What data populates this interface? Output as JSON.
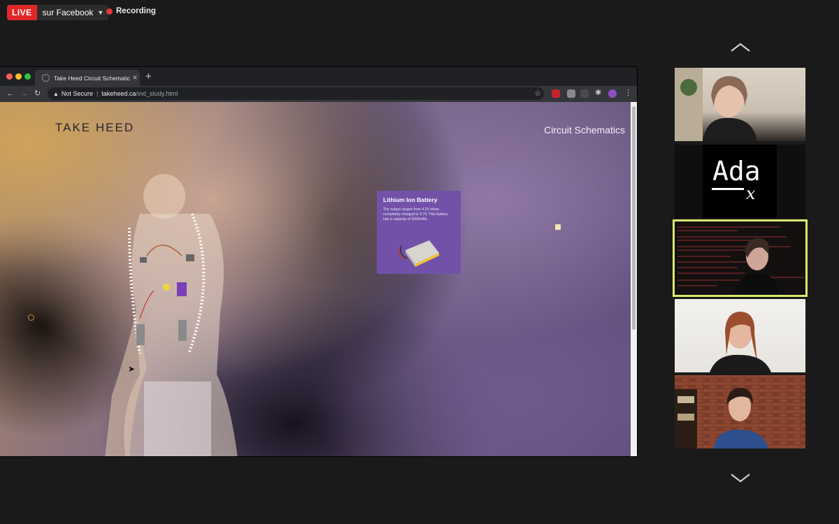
{
  "top_bar": {
    "live_label": "LIVE",
    "live_destination": "sur Facebook",
    "recording_label": "Recording"
  },
  "browser": {
    "tab_title": "Take Heed Circuit Schematics",
    "new_tab_symbol": "+",
    "security_label": "Not Secure",
    "url_domain": "takeheed.ca",
    "url_path": "/ind_study.html"
  },
  "page": {
    "brand": "TAKE HEED",
    "nav_link": "Circuit Schematics",
    "card": {
      "title": "Lithium Ion Battery",
      "body": "The output ranges from 4.2V when completely charged to 3.7V. This battery has a capacity of 2000mAh."
    }
  },
  "participants": {
    "logo_text": "Ada",
    "logo_subscript": "x",
    "tiles": [
      {
        "name": "participant-1",
        "active": false
      },
      {
        "name": "adax-logo",
        "active": false
      },
      {
        "name": "participant-3",
        "active": true
      },
      {
        "name": "participant-4",
        "active": false
      },
      {
        "name": "participant-5",
        "active": false
      }
    ]
  },
  "colors": {
    "live_red": "#e02828",
    "active_speaker": "#d9e86d",
    "card_purple": "#7152a8"
  },
  "icons": [
    "caret-down-icon",
    "recording-dot-icon",
    "close-icon",
    "back-icon",
    "forward-icon",
    "reload-icon",
    "warning-icon",
    "star-icon",
    "extensions-icon",
    "menu-icon",
    "chevron-up-icon",
    "chevron-down-icon"
  ]
}
